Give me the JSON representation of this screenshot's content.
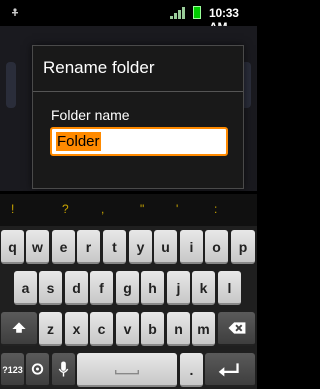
{
  "status": {
    "time": "10:33 AM"
  },
  "dialog": {
    "title": "Rename folder",
    "field_label": "Folder name",
    "field_value": "Folder"
  },
  "suggestions": [
    "!",
    "?",
    ",",
    "\"",
    "'",
    ":"
  ],
  "keyboard": {
    "row1": [
      "q",
      "w",
      "e",
      "r",
      "t",
      "y",
      "u",
      "i",
      "o",
      "p"
    ],
    "row2": [
      "a",
      "s",
      "d",
      "f",
      "g",
      "h",
      "j",
      "k",
      "l"
    ],
    "row3": [
      "z",
      "x",
      "c",
      "v",
      "b",
      "n",
      "m"
    ],
    "symbols_label": "?123",
    "period_label": ".",
    "colors": {
      "accent": "#ff8a00",
      "suggestion": "#c8a400"
    }
  }
}
